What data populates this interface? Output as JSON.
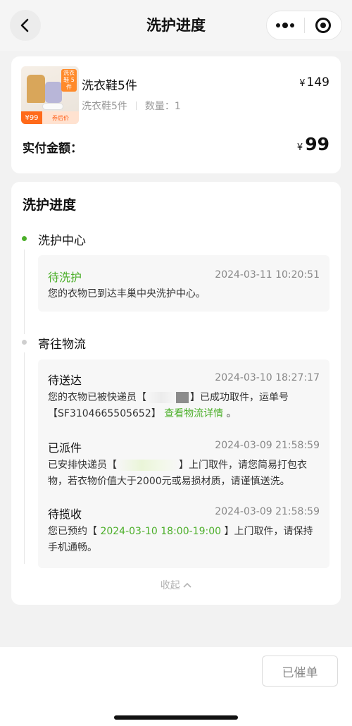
{
  "nav": {
    "title": "洗护进度"
  },
  "order": {
    "product_name": "洗衣鞋5件",
    "price_symbol": "¥",
    "price": "149",
    "spec": "洗衣鞋5件",
    "quantity": "数量：1",
    "thumb_tag": "洗衣鞋 5件",
    "thumb_price": "¥99",
    "thumb_coupon": "券后价",
    "paid_label": "实付金额：",
    "paid_symbol": "¥",
    "paid_amount": "99"
  },
  "progress": {
    "title": "洗护进度",
    "stages": [
      {
        "label": "洗护中心",
        "events": [
          {
            "status": "待洗护",
            "time": "2024-03-11 10:20:51",
            "desc": "您的衣物已到达丰巢中央洗护中心。"
          }
        ]
      },
      {
        "label": "寄往物流",
        "events": [
          {
            "status": "待送达",
            "time": "2024-03-10 18:27:17",
            "desc_pre": "您的衣物已被快递员【",
            "desc_mid": "】已成功取件，运单号【SF3104665505652】",
            "desc_link": "查看物流详情",
            "desc_post": "。"
          },
          {
            "status": "已派件",
            "time": "2024-03-09 21:58:59",
            "desc_pre": "已安排快递员【",
            "desc_post": "】上门取件，请您简易打包衣物，若衣物价值大于2000元或易损材质，请谨慎送洗。"
          },
          {
            "status": "待揽收",
            "time": "2024-03-09 21:58:59",
            "desc_pre": "您已预约【",
            "desc_hl": "2024-03-10 18:00-19:00",
            "desc_post": "】上门取件，请保持手机通畅。"
          }
        ]
      }
    ],
    "collapse_label": "收起"
  },
  "bottom": {
    "urge_button": "已催单"
  },
  "colors": {
    "accent_green": "#4caf2a",
    "stage_inactive": "#cfcfcf"
  }
}
